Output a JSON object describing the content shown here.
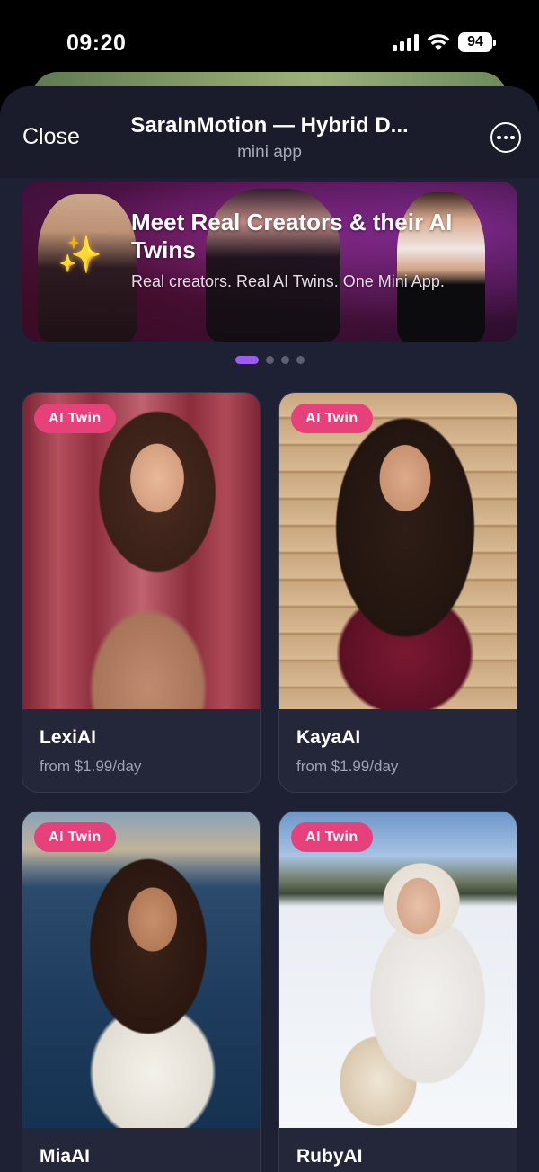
{
  "status_bar": {
    "time": "09:20",
    "battery": "94"
  },
  "header": {
    "close_label": "Close",
    "title": "SaraInMotion — Hybrid D...",
    "subtitle": "mini app"
  },
  "banner": {
    "title": "Meet Real Creators & their AI Twins",
    "subtitle": "Real creators. Real AI Twins. One Mini App.",
    "sparkle_icon": "✨",
    "dots_total": 4,
    "active_dot": 0
  },
  "cards": [
    {
      "badge": "AI Twin",
      "name": "LexiAI",
      "price": "from $1.99/day"
    },
    {
      "badge": "AI Twin",
      "name": "KayaAI",
      "price": "from $1.99/day"
    },
    {
      "badge": "AI Twin",
      "name": "MiaAI"
    },
    {
      "badge": "AI Twin",
      "name": "RubyAI"
    }
  ],
  "colors": {
    "accent": "#9b5cf0",
    "badge": "#e7417b",
    "background": "#1e2033"
  }
}
